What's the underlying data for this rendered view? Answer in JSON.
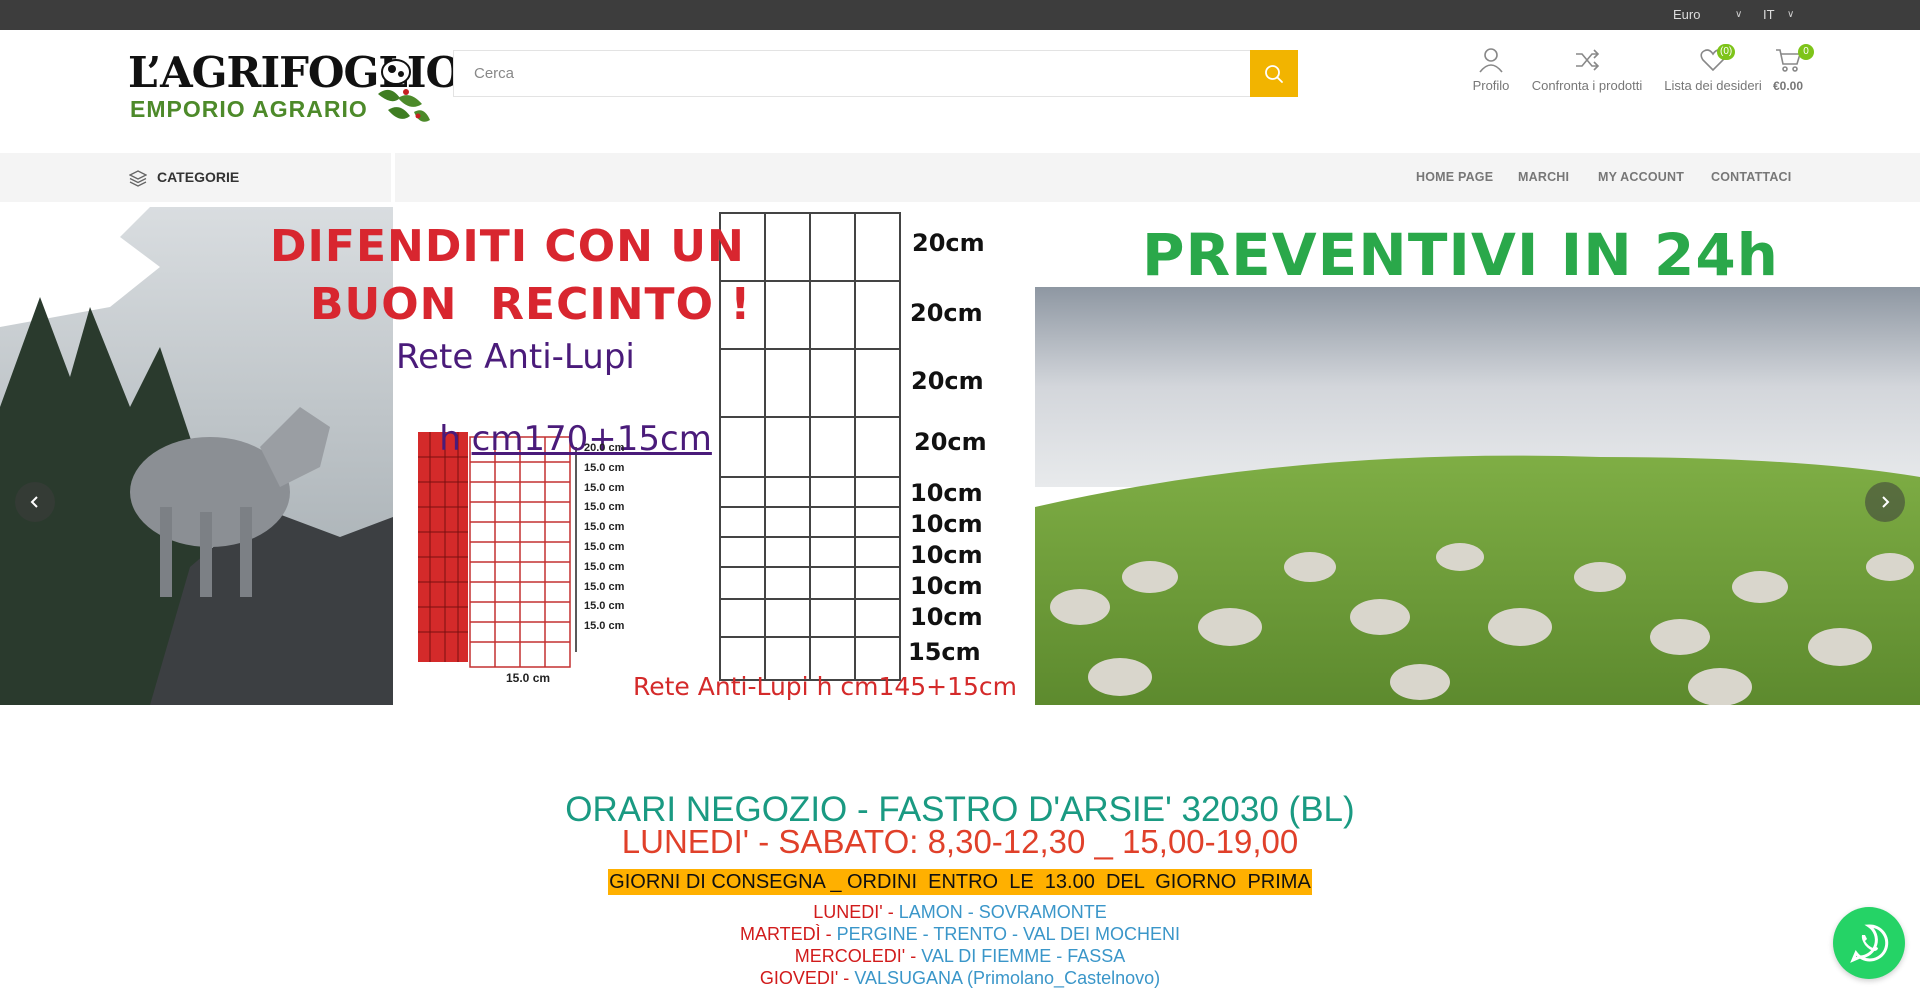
{
  "topbar": {
    "currency": "Euro",
    "language": "IT"
  },
  "logo": {
    "line1": "L’AGRIFOGLIO",
    "line2": "EMPORIO AGRARIO"
  },
  "search": {
    "placeholder": "Cerca"
  },
  "header_icons": {
    "profile": "Profilo",
    "compare": "Confronta i prodotti",
    "wishlist": "Lista dei desideri",
    "wishlist_count": "(0)",
    "cart_count": "0",
    "cart_total": "€0.00"
  },
  "nav": {
    "categories": "CATEGORIE",
    "links": [
      "HOME PAGE",
      "MARCHI",
      "MY ACCOUNT",
      "CONTATTACI"
    ]
  },
  "banner": {
    "title_line1": "DIFENDITI CON UN",
    "title_line2": "BUON  RECINTO !",
    "product1_line1": "Rete Anti-Lupi",
    "product1_line2_prefix": "h ",
    "product1_line2_link": "cm170+15cm",
    "product1_spacings": [
      "20.0 cm",
      "15.0 cm",
      "15.0 cm",
      "15.0 cm",
      "15.0 cm",
      "15.0 cm",
      "15.0 cm",
      "15.0 cm",
      "15.0 cm",
      "15.0 cm"
    ],
    "product1_width": "15.0 cm",
    "product2_spacings": [
      "20cm",
      "20cm",
      "20cm",
      "20cm",
      "10cm",
      "10cm",
      "10cm",
      "10cm",
      "10cm",
      "15cm"
    ],
    "product2_label": "Rete Anti-Lupi h cm145+15cm",
    "right_title": "PREVENTIVI IN 24h"
  },
  "info": {
    "hours_title": "ORARI NEGOZIO - FASTRO D'ARSIE' 32030 (BL)",
    "hours": "LUNEDI' - SABATO: 8,30-12,30 _ 15,00-19,00",
    "delivery_title": "GIORNI DI CONSEGNA _ ORDINI  ENTRO  LE  13.00  DEL  GIORNO  PRIMA",
    "days": [
      {
        "day": "LUNEDI' - ",
        "places": "LAMON - SOVRAMONTE"
      },
      {
        "day": "MARTEDÌ - ",
        "places": "PERGINE - TRENTO - VAL DEI MOCHENI"
      },
      {
        "day": "MERCOLEDI' - ",
        "places": "VAL DI FIEMME - FASSA"
      },
      {
        "day": "GIOVEDI' - ",
        "places": "VALSUGANA (Primolano_Castelnovo)"
      }
    ]
  },
  "colors": {
    "accent": "#f2b400",
    "badge": "#7ec41a",
    "topbar": "#3d3d3d",
    "teal": "#1a9a82",
    "red": "#e0402a"
  }
}
